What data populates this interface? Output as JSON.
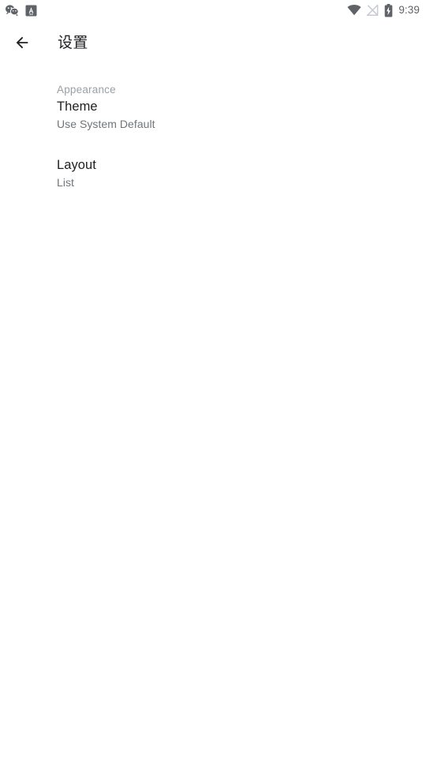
{
  "status_bar": {
    "notifications": [
      {
        "icon": "wechat-bubbles-icon",
        "label": "WeChat"
      },
      {
        "icon": "app-letter-a-icon",
        "label": "A"
      }
    ],
    "wifi_icon": "wifi-icon",
    "signal_icon": "no-signal-icon",
    "battery_icon": "battery-charging-icon",
    "time": "9:39",
    "colors": {
      "icon_dark": "#5f6368",
      "icon_light": "#c8cbcf",
      "text": "#5f6368"
    }
  },
  "app_bar": {
    "back_icon": "arrow-back-icon",
    "title": "设置"
  },
  "settings": {
    "sections": [
      {
        "header": "Appearance",
        "items": [
          {
            "title": "Theme",
            "summary": "Use System Default"
          },
          {
            "title": "Layout",
            "summary": "List"
          }
        ]
      }
    ]
  },
  "theme_colors": {
    "background": "#ffffff",
    "primary_text": "#202124",
    "secondary_text": "#70757a",
    "header_text": "#9aa0a6"
  }
}
